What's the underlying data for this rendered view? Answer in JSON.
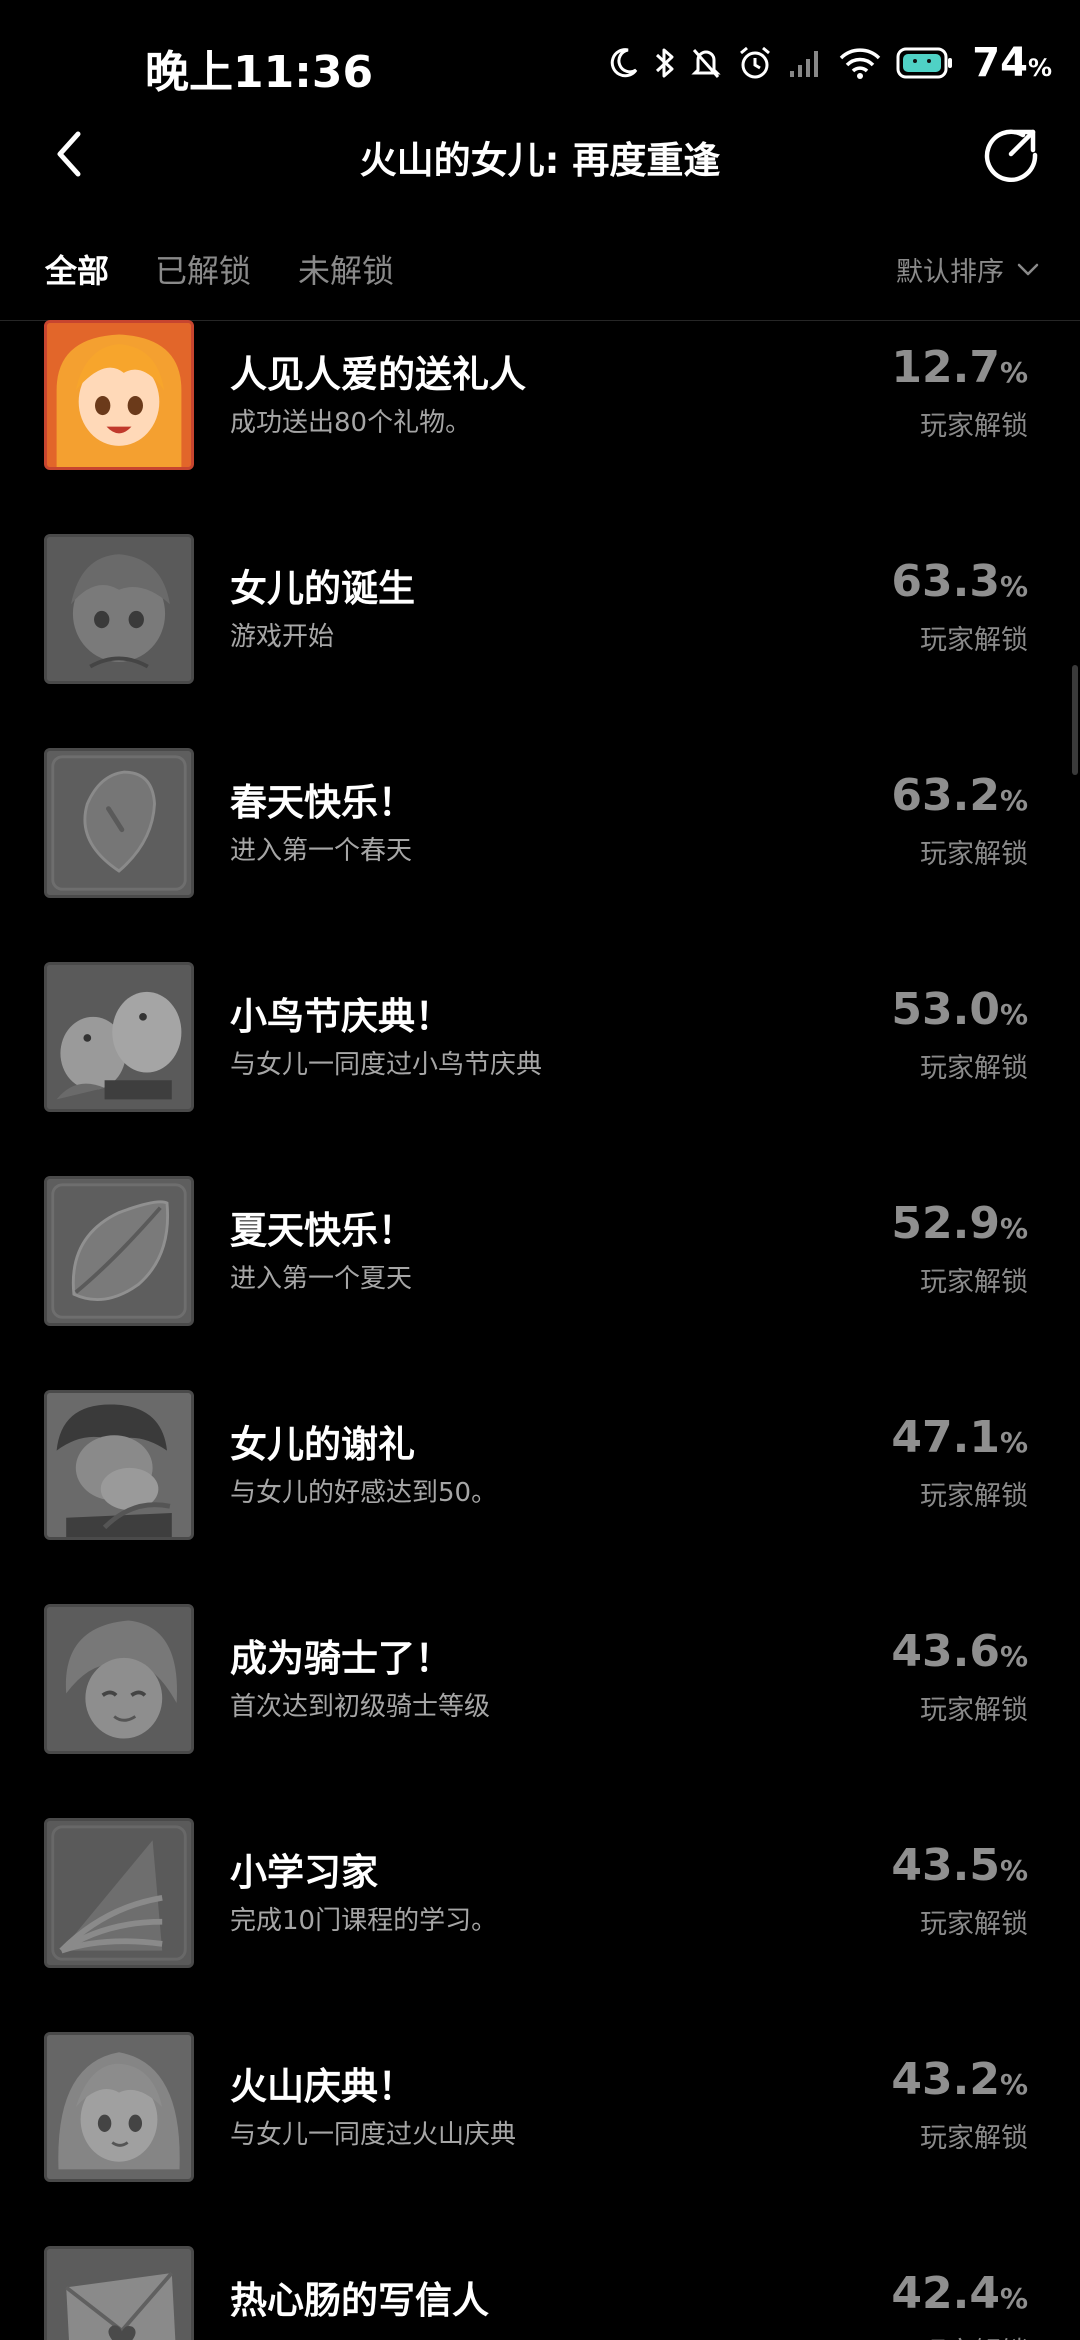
{
  "status_bar": {
    "time": "晚上11:36",
    "battery_percent": "74",
    "battery_unit": "%",
    "icons": [
      "moon-icon",
      "bluetooth-icon",
      "mute-icon",
      "alarm-icon",
      "signal-icon",
      "wifi-icon",
      "battery-icon"
    ]
  },
  "header": {
    "title": "火山的女儿: 再度重逢",
    "back_icon": "chevron-left-icon",
    "share_icon": "share-icon"
  },
  "tabs": {
    "items": [
      {
        "label": "全部",
        "active": true
      },
      {
        "label": "已解锁",
        "active": false
      },
      {
        "label": "未解锁",
        "active": false
      }
    ],
    "sort_label": "默认排序"
  },
  "achievements": [
    {
      "title": "人见人爱的送礼人",
      "desc": "成功送出80个礼物。",
      "pct": "12.7",
      "unit": "%",
      "label": "玩家解锁",
      "unlocked": true,
      "icon": "girl-portrait-icon"
    },
    {
      "title": "女儿的诞生",
      "desc": "游戏开始",
      "pct": "63.3",
      "unit": "%",
      "label": "玩家解锁",
      "unlocked": false,
      "icon": "baby-icon"
    },
    {
      "title": "春天快乐！",
      "desc": "进入第一个春天",
      "pct": "63.2",
      "unit": "%",
      "label": "玩家解锁",
      "unlocked": false,
      "icon": "petal-icon"
    },
    {
      "title": "小鸟节庆典！",
      "desc": "与女儿一同度过小鸟节庆典",
      "pct": "53.0",
      "unit": "%",
      "label": "玩家解锁",
      "unlocked": false,
      "icon": "birds-icon"
    },
    {
      "title": "夏天快乐！",
      "desc": "进入第一个夏天",
      "pct": "52.9",
      "unit": "%",
      "label": "玩家解锁",
      "unlocked": false,
      "icon": "leaf-icon"
    },
    {
      "title": "女儿的谢礼",
      "desc": "与女儿的好感达到50。",
      "pct": "47.1",
      "unit": "%",
      "label": "玩家解锁",
      "unlocked": false,
      "icon": "hug-icon"
    },
    {
      "title": "成为骑士了！",
      "desc": "首次达到初级骑士等级",
      "pct": "43.6",
      "unit": "%",
      "label": "玩家解锁",
      "unlocked": false,
      "icon": "knight-icon"
    },
    {
      "title": "小学习家",
      "desc": "完成10门课程的学习。",
      "pct": "43.5",
      "unit": "%",
      "label": "玩家解锁",
      "unlocked": false,
      "icon": "book-icon"
    },
    {
      "title": "火山庆典！",
      "desc": "与女儿一同度过火山庆典",
      "pct": "43.2",
      "unit": "%",
      "label": "玩家解锁",
      "unlocked": false,
      "icon": "festival-girl-icon"
    },
    {
      "title": "热心肠的写信人",
      "desc": "",
      "pct": "42.4",
      "unit": "%",
      "label": "玩家解锁",
      "unlocked": false,
      "icon": "letter-icon"
    }
  ]
}
